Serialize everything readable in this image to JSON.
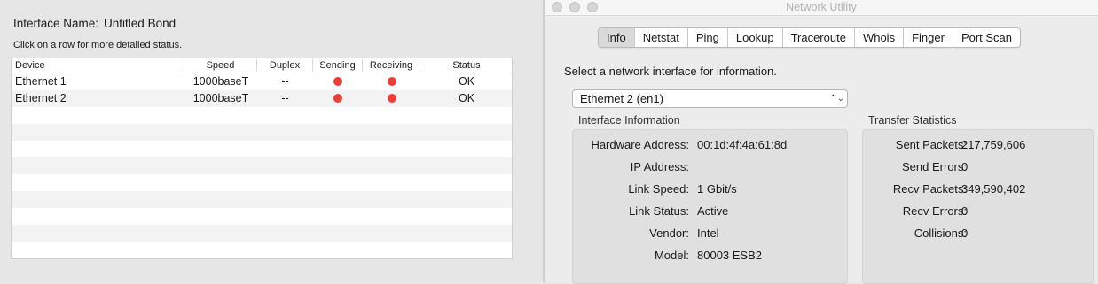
{
  "bond": {
    "name_label": "Interface Name:",
    "name_value": "Untitled Bond",
    "hint": "Click on a row for more detailed status.",
    "columns": [
      "Device",
      "Speed",
      "Duplex",
      "Sending",
      "Receiving",
      "Status"
    ],
    "rows": [
      {
        "device": "Ethernet 1",
        "speed": "1000baseT",
        "duplex": "--",
        "sending": "red-dot",
        "receiving": "red-dot",
        "status": "OK"
      },
      {
        "device": "Ethernet 2",
        "speed": "1000baseT",
        "duplex": "--",
        "sending": "red-dot",
        "receiving": "red-dot",
        "status": "OK"
      }
    ],
    "dot_color": "#e8413c"
  },
  "window": {
    "title": "Network Utility",
    "tabs": [
      "Info",
      "Netstat",
      "Ping",
      "Lookup",
      "Traceroute",
      "Whois",
      "Finger",
      "Port Scan"
    ],
    "active_tab": "Info",
    "select_label": "Select a network interface for information.",
    "selected_interface": "Ethernet 2 (en1)",
    "interface_info": {
      "title": "Interface Information",
      "items": [
        {
          "label": "Hardware Address:",
          "value": "00:1d:4f:4a:61:8d"
        },
        {
          "label": "IP Address:",
          "value": ""
        },
        {
          "label": "Link Speed:",
          "value": "1 Gbit/s"
        },
        {
          "label": "Link Status:",
          "value": "Active"
        },
        {
          "label": "Vendor:",
          "value": "Intel"
        },
        {
          "label": "Model:",
          "value": "80003 ESB2"
        }
      ]
    },
    "transfer_stats": {
      "title": "Transfer Statistics",
      "items": [
        {
          "label": "Sent Packets:",
          "value": "217,759,606"
        },
        {
          "label": "Send Errors:",
          "value": "0"
        },
        {
          "label": "Recv Packets:",
          "value": "349,590,402"
        },
        {
          "label": "Recv Errors:",
          "value": "0"
        },
        {
          "label": "Collisions:",
          "value": "0"
        }
      ]
    }
  }
}
